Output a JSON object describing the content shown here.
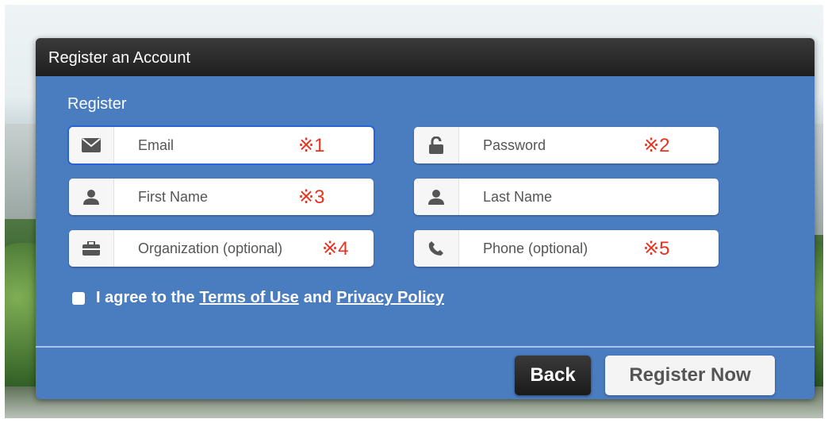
{
  "dialog": {
    "title": "Register an Account",
    "section_label": "Register"
  },
  "fields": {
    "email": {
      "placeholder": "Email",
      "note": "※1",
      "icon": "envelope-icon"
    },
    "password": {
      "placeholder": "Password",
      "note": "※2",
      "icon": "lock-icon"
    },
    "first_name": {
      "placeholder": "First Name",
      "note": "※3",
      "icon": "user-icon"
    },
    "last_name": {
      "placeholder": "Last Name",
      "note": "",
      "icon": "user-icon"
    },
    "organization": {
      "placeholder": "Organization (optional)",
      "note": "※4",
      "icon": "briefcase-icon"
    },
    "phone": {
      "placeholder": "Phone (optional)",
      "note": "※5",
      "icon": "phone-icon"
    }
  },
  "agree": {
    "prefix": "I agree to the",
    "terms": "Terms of Use",
    "and": "and",
    "privacy": "Privacy Policy"
  },
  "buttons": {
    "back": "Back",
    "register": "Register Now"
  },
  "colors": {
    "dialog_bg": "#4a7cc0",
    "titlebar": "#1e1e1e",
    "note": "#e8321f",
    "focus": "#2b63d6"
  }
}
